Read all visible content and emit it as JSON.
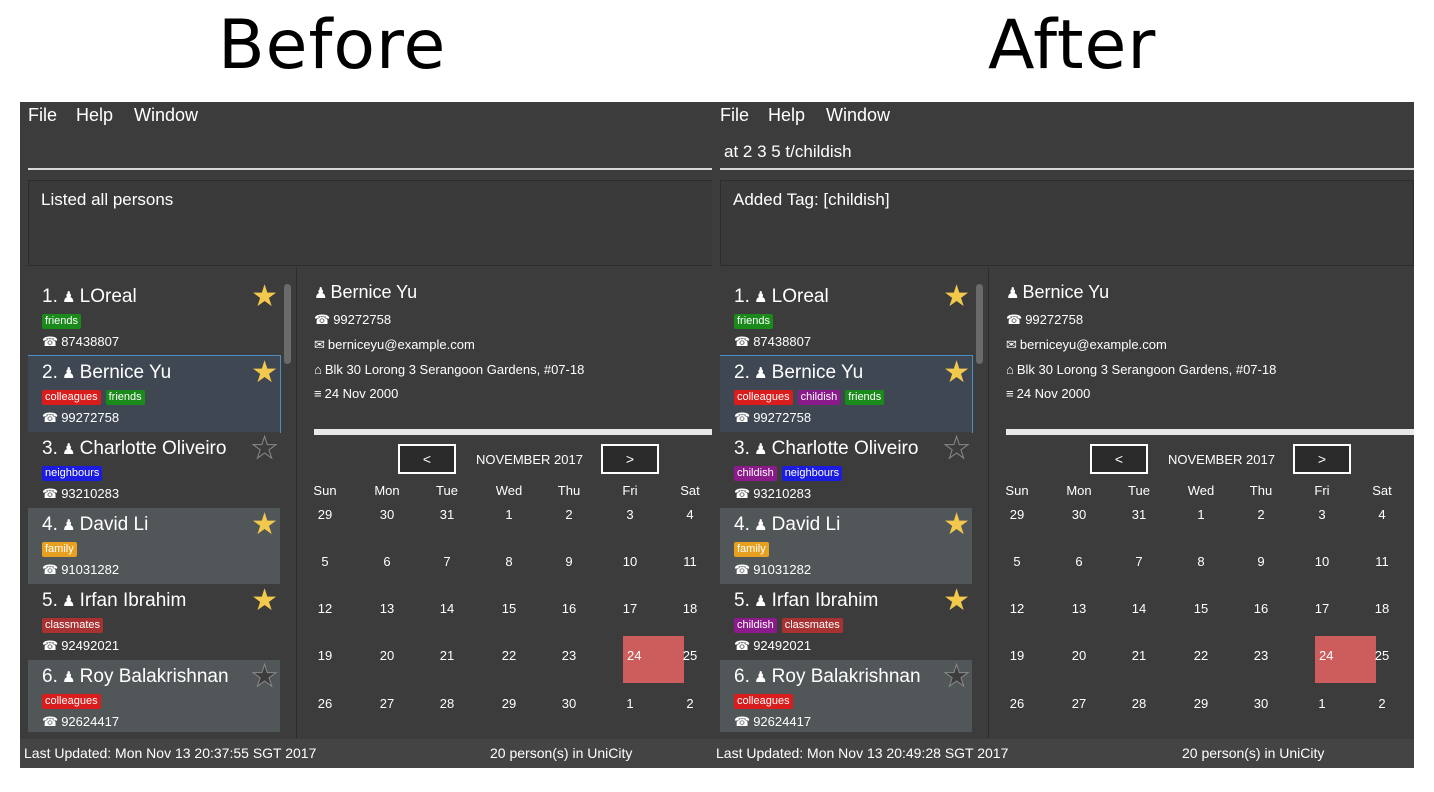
{
  "captions": {
    "before": "Before",
    "after": "After"
  },
  "menu": [
    "File",
    "Help",
    "Window"
  ],
  "colors": {
    "friends": "#1a8a1a",
    "colleagues": "#d91c1c",
    "neighbours": "#1c1ce0",
    "family": "#e8a020",
    "classmates": "#a83232",
    "childish": "#8b1a8b",
    "highlight_day": "#cd5c5c",
    "star": "#f2c94c"
  },
  "icons": {
    "person": "person-icon",
    "phone": "phone-icon",
    "email": "email-icon",
    "address": "building-icon",
    "birthday": "cake-icon",
    "star": "star-icon"
  },
  "before": {
    "command": "",
    "result": "Listed all persons",
    "persons": [
      {
        "index": "1.",
        "name": "LOreal",
        "tags": [
          {
            "label": "friends",
            "kind": "friends"
          }
        ],
        "phone": "87438807",
        "fav": true
      },
      {
        "index": "2.",
        "name": "Bernice Yu",
        "tags": [
          {
            "label": "colleagues",
            "kind": "colleagues"
          },
          {
            "label": "friends",
            "kind": "friends"
          }
        ],
        "phone": "99272758",
        "fav": true
      },
      {
        "index": "3.",
        "name": "Charlotte Oliveiro",
        "tags": [
          {
            "label": "neighbours",
            "kind": "neighbours"
          }
        ],
        "phone": "93210283",
        "fav": false
      },
      {
        "index": "4.",
        "name": "David Li",
        "tags": [
          {
            "label": "family",
            "kind": "family"
          }
        ],
        "phone": "91031282",
        "fav": true
      },
      {
        "index": "5.",
        "name": "Irfan Ibrahim",
        "tags": [
          {
            "label": "classmates",
            "kind": "classmates"
          }
        ],
        "phone": "92492021",
        "fav": true
      },
      {
        "index": "6.",
        "name": "Roy Balakrishnan",
        "tags": [
          {
            "label": "colleagues",
            "kind": "colleagues"
          }
        ],
        "phone": "92624417",
        "fav": false
      }
    ],
    "status_left": "Last Updated: Mon Nov 13 20:37:55 SGT 2017",
    "status_right": "20 person(s) in UniCity"
  },
  "after": {
    "command": "at 2 3 5 t/childish",
    "result": "Added Tag: [childish]",
    "persons": [
      {
        "index": "1.",
        "name": "LOreal",
        "tags": [
          {
            "label": "friends",
            "kind": "friends"
          }
        ],
        "phone": "87438807",
        "fav": true
      },
      {
        "index": "2.",
        "name": "Bernice Yu",
        "tags": [
          {
            "label": "colleagues",
            "kind": "colleagues"
          },
          {
            "label": "childish",
            "kind": "childish"
          },
          {
            "label": "friends",
            "kind": "friends"
          }
        ],
        "phone": "99272758",
        "fav": true
      },
      {
        "index": "3.",
        "name": "Charlotte Oliveiro",
        "tags": [
          {
            "label": "childish",
            "kind": "childish"
          },
          {
            "label": "neighbours",
            "kind": "neighbours"
          }
        ],
        "phone": "93210283",
        "fav": false
      },
      {
        "index": "4.",
        "name": "David Li",
        "tags": [
          {
            "label": "family",
            "kind": "family"
          }
        ],
        "phone": "91031282",
        "fav": true
      },
      {
        "index": "5.",
        "name": "Irfan Ibrahim",
        "tags": [
          {
            "label": "childish",
            "kind": "childish"
          },
          {
            "label": "classmates",
            "kind": "classmates"
          }
        ],
        "phone": "92492021",
        "fav": true
      },
      {
        "index": "6.",
        "name": "Roy Balakrishnan",
        "tags": [
          {
            "label": "colleagues",
            "kind": "colleagues"
          }
        ],
        "phone": "92624417",
        "fav": false
      }
    ],
    "status_left": "Last Updated: Mon Nov 13 20:49:28 SGT 2017",
    "status_right": "20 person(s) in UniCity"
  },
  "selected_index": 1,
  "detail": {
    "name": "Bernice Yu",
    "phone": "99272758",
    "email": "berniceyu@example.com",
    "address": "Blk 30 Lorong 3 Serangoon Gardens, #07-18",
    "birthday": "24 Nov 2000"
  },
  "calendar": {
    "prev": "<",
    "next": ">",
    "month": "NOVEMBER 2017",
    "day_names": [
      "Sun",
      "Mon",
      "Tue",
      "Wed",
      "Thu",
      "Fri",
      "Sat"
    ],
    "weeks": [
      [
        "29",
        "30",
        "31",
        "1",
        "2",
        "3",
        "4"
      ],
      [
        "5",
        "6",
        "7",
        "8",
        "9",
        "10",
        "11"
      ],
      [
        "12",
        "13",
        "14",
        "15",
        "16",
        "17",
        "18"
      ],
      [
        "19",
        "20",
        "21",
        "22",
        "23",
        "24",
        "25"
      ],
      [
        "26",
        "27",
        "28",
        "29",
        "30",
        "1",
        "2"
      ]
    ],
    "highlight": "24"
  }
}
